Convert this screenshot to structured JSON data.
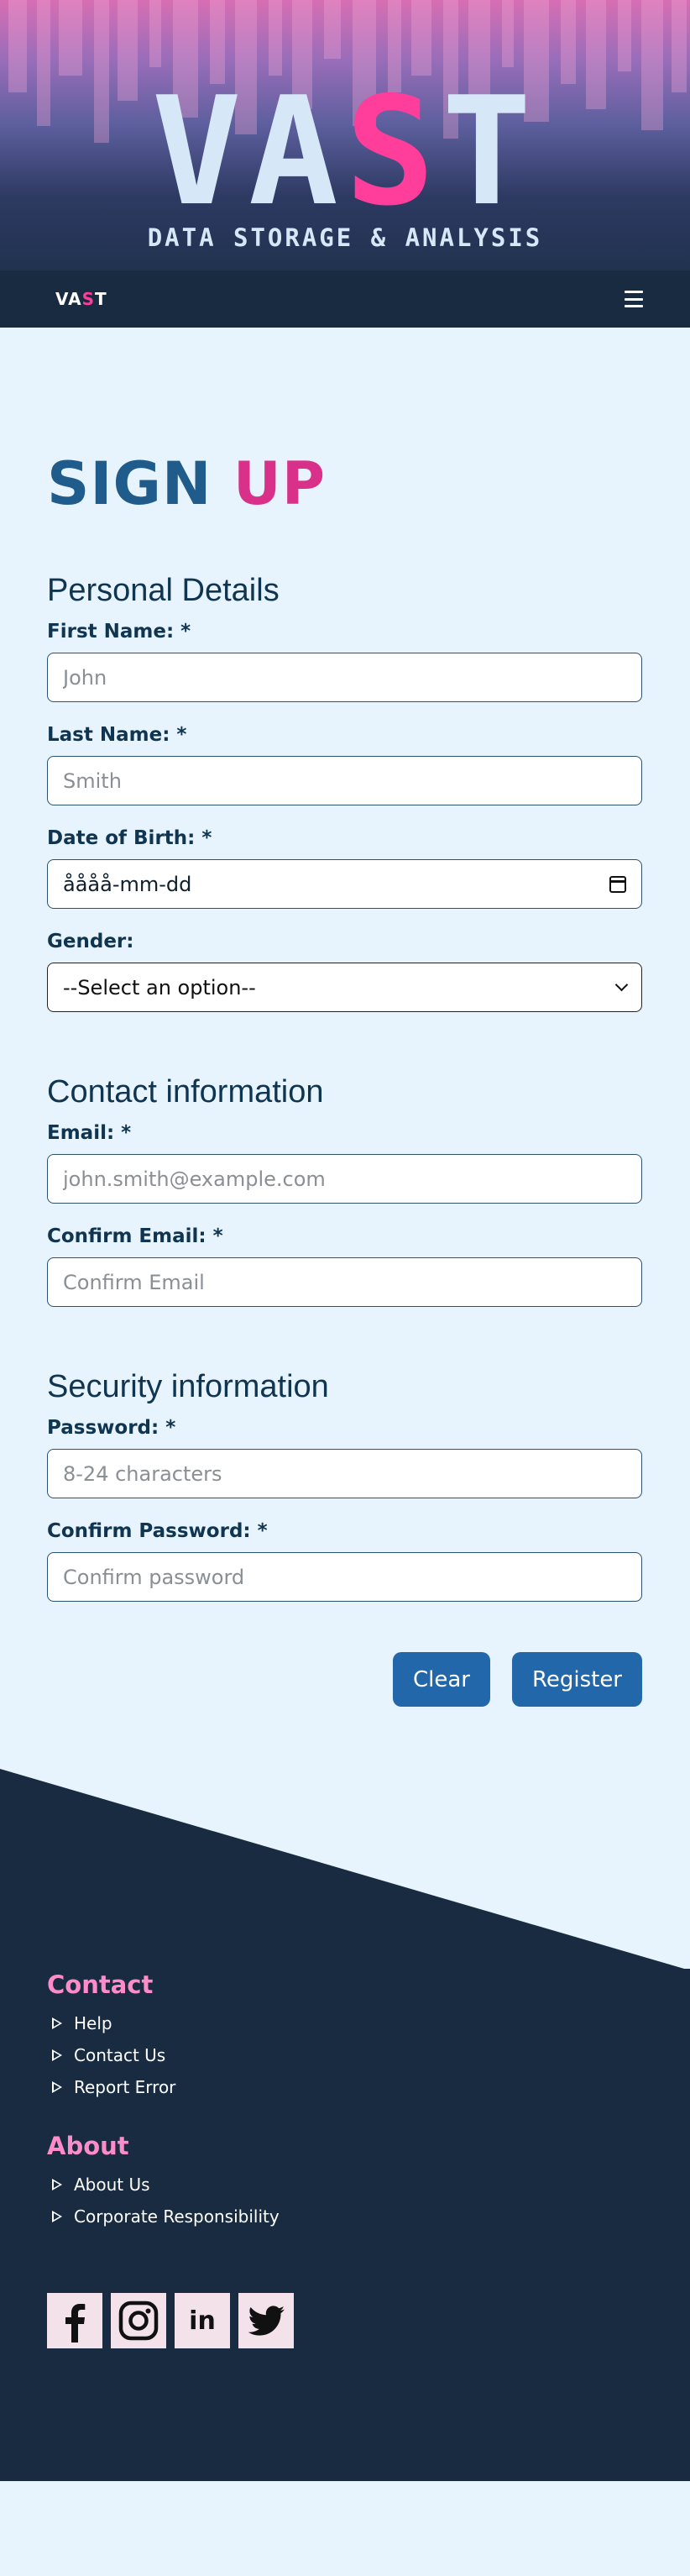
{
  "hero": {
    "logo_main": "VA",
    "logo_accent": "S",
    "logo_end": "T",
    "subtitle": "DATA STORAGE & ANALYSIS"
  },
  "navbar": {
    "brand_main": "VA",
    "brand_accent": "S",
    "brand_end": "T",
    "menu_icon": "hamburger-icon"
  },
  "page": {
    "title_main": "SIGN",
    "title_accent": "UP"
  },
  "sections": {
    "personal": {
      "heading": "Personal Details",
      "first_name_label": "First Name: *",
      "first_name_placeholder": "John",
      "last_name_label": "Last Name: *",
      "last_name_placeholder": "Smith",
      "dob_label": "Date of Birth: *",
      "dob_value": "åååå-mm-dd",
      "gender_label": "Gender:",
      "gender_selected": "--Select an option--"
    },
    "contact": {
      "heading": "Contact information",
      "email_label": "Email: *",
      "email_placeholder": "john.smith@example.com",
      "confirm_email_label": "Confirm Email: *",
      "confirm_email_placeholder": "Confirm Email"
    },
    "security": {
      "heading": "Security information",
      "password_label": "Password: *",
      "password_placeholder": "8-24 characters",
      "confirm_password_label": "Confirm Password: *",
      "confirm_password_placeholder": "Confirm password"
    }
  },
  "actions": {
    "clear_label": "Clear",
    "register_label": "Register"
  },
  "footer": {
    "contact_heading": "Contact",
    "contact_links": [
      "Help",
      "Contact Us",
      "Report Error"
    ],
    "about_heading": "About",
    "about_links": [
      "About Us",
      "Corporate Responsibility"
    ],
    "social": [
      "facebook-icon",
      "instagram-icon",
      "linkedin-icon",
      "twitter-icon"
    ],
    "linkedin_text": "in"
  },
  "colors": {
    "accent_pink": "#ff3d9a",
    "title_blue": "#1f5c8c",
    "title_pink": "#d9318a",
    "button_blue": "#2267aa",
    "footer_bg": "#182b40",
    "footer_heading": "#ff8cc8",
    "page_bg": "#e8f4fd"
  }
}
